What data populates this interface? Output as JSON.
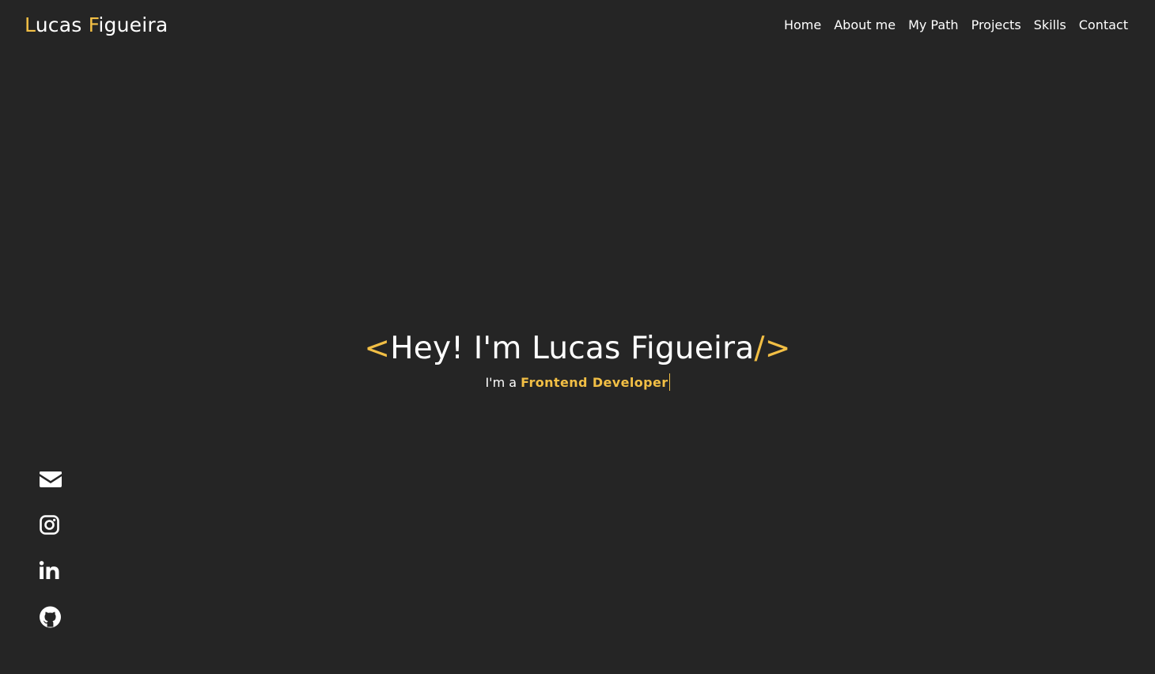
{
  "header": {
    "brand_first": "Lucas",
    "brand_last": "Figueira",
    "nav": [
      {
        "label": "Home"
      },
      {
        "label": "About me"
      },
      {
        "label": "My Path"
      },
      {
        "label": "Projects"
      },
      {
        "label": "Skills"
      },
      {
        "label": "Contact"
      }
    ]
  },
  "hero": {
    "open_bracket": "<",
    "title": "Hey! I'm Lucas Figueira",
    "close_bracket": "/>",
    "intro": "I'm a",
    "role": "Frontend Developer"
  },
  "social": [
    {
      "icon": "envelope-icon"
    },
    {
      "icon": "instagram-icon"
    },
    {
      "icon": "linkedin-icon"
    },
    {
      "icon": "github-icon"
    }
  ],
  "colors": {
    "background": "#252525",
    "accent": "#f2bf45",
    "text": "#ffffff"
  }
}
